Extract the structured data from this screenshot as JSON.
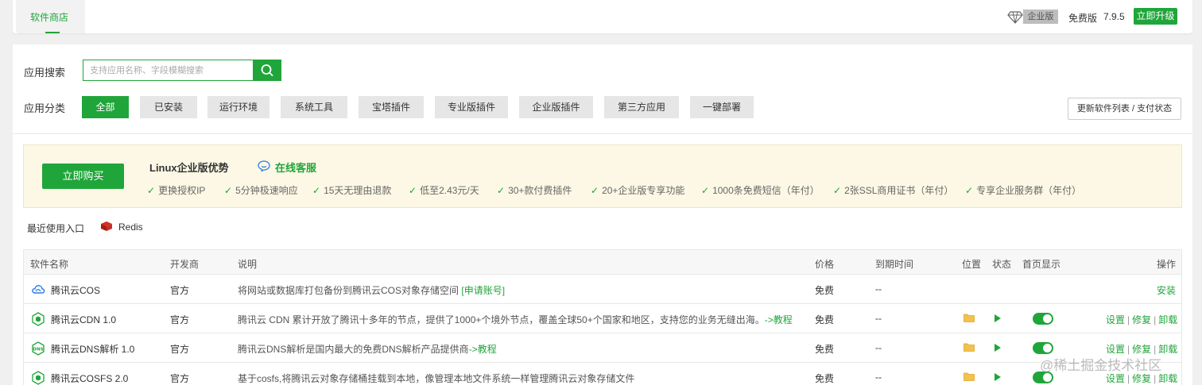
{
  "topbar": {
    "tab_label": "软件商店",
    "edition_badge": "企业版",
    "free_label": "免费版",
    "version": "7.9.5",
    "upgrade_label": "立即升级"
  },
  "search": {
    "label": "应用搜索",
    "placeholder": "支持应用名称、字段模糊搜索"
  },
  "categories": {
    "label": "应用分类",
    "items": [
      "全部",
      "已安装",
      "运行环境",
      "系统工具",
      "宝塔插件",
      "专业版插件",
      "企业版插件",
      "第三方应用",
      "一键部署"
    ],
    "active": "全部"
  },
  "update_label": "更新软件列表 / 支付状态",
  "promo": {
    "buy_label": "立即购买",
    "title": "Linux企业版优势",
    "cs_label": "在线客服",
    "perks": [
      "更换授权IP",
      "5分钟极速响应",
      "15天无理由退款",
      "低至2.43元/天",
      "30+款付费插件",
      "20+企业版专享功能",
      "1000条免费短信（年付）",
      "2张SSL商用证书（年付）",
      "专享企业服务群（年付）"
    ]
  },
  "recent": {
    "label": "最近使用入口",
    "items": [
      "Redis"
    ]
  },
  "table": {
    "headers": {
      "name": "软件名称",
      "developer": "开发商",
      "description": "说明",
      "price": "价格",
      "expiry": "到期时间",
      "location": "位置",
      "status": "状态",
      "homepage": "首页显示",
      "ops": "操作"
    },
    "rows": [
      {
        "name": "腾讯云COS",
        "developer": "官方",
        "description": "将网站或数据库打包备份到腾讯云COS对象存储空间",
        "desc_link": "[申请账号]",
        "price": "免费",
        "expiry": "--",
        "action": "安装"
      },
      {
        "name": "腾讯云CDN 1.0",
        "developer": "官方",
        "description": "腾讯云 CDN 累计开放了腾讯十多年的节点，提供了1000+个境外节点，覆盖全球50+个国家和地区，支持您的业务无缝出海。",
        "desc_link": "->教程",
        "price": "免费",
        "expiry": "--",
        "op_set": "设置",
        "op_fix": "修复",
        "op_remove": "卸载"
      },
      {
        "name": "腾讯云DNS解析 1.0",
        "developer": "官方",
        "description": "腾讯云DNS解析是国内最大的免费DNS解析产品提供商",
        "desc_link": "->教程",
        "price": "免费",
        "expiry": "--",
        "op_set": "设置",
        "op_fix": "修复",
        "op_remove": "卸载"
      },
      {
        "name": "腾讯云COSFS 2.0",
        "developer": "官方",
        "description": "基于cosfs,将腾讯云对象存储桶挂载到本地，像管理本地文件系统一样管理腾讯云对象存储文件",
        "desc_link": "",
        "price": "免费",
        "expiry": "--",
        "op_set": "设置",
        "op_fix": "修复",
        "op_remove": "卸载"
      }
    ]
  },
  "watermark": "@稀土掘金技术社区",
  "colors": {
    "brand_green": "#20a53a",
    "promo_bg": "#fcf8e5",
    "page_bg": "#f0f0f0"
  }
}
